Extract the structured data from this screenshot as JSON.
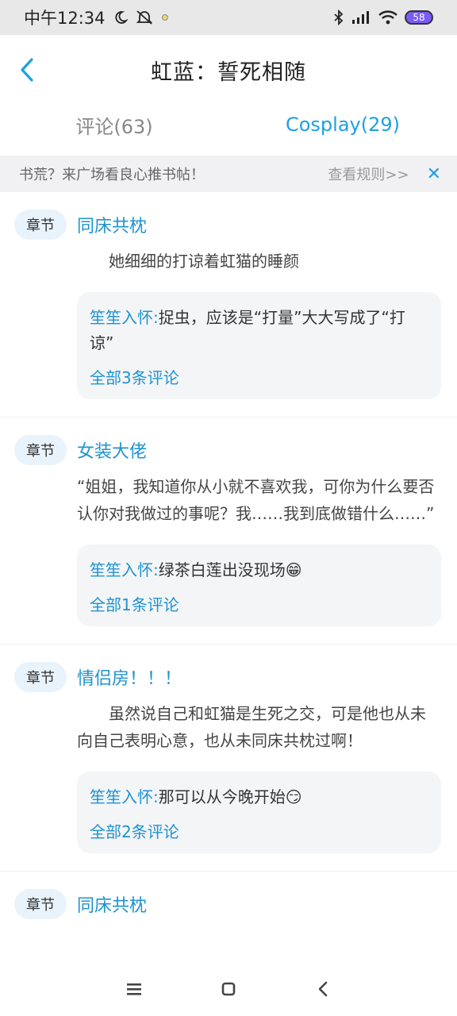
{
  "status_bar": {
    "time": "中午12:34",
    "battery": "58"
  },
  "nav": {
    "title": "虹蓝：誓死相随"
  },
  "tabs": [
    {
      "label": "评论(63)"
    },
    {
      "label": "Cosplay(29)"
    }
  ],
  "notice": {
    "text": "书荒？来广场看良心推书帖！",
    "link": "查看规则>>",
    "close": "✕"
  },
  "cards": [
    {
      "tag": "章节",
      "title": "同床共枕",
      "quote": "　　她细细的打谅着虹猫的睡颜",
      "comment_user": "笙笙入怀:",
      "comment_text": "捉虫，应该是“打量”大大写成了“打谅”",
      "more": "全部3条评论"
    },
    {
      "tag": "章节",
      "title": "女装大佬",
      "quote": "“姐姐，我知道你从小就不喜欢我，可你为什么要否认你对我做过的事呢？我……我到底做错什么……”",
      "comment_user": "笙笙入怀:",
      "comment_text": "绿茶白莲出没现场😁",
      "more": "全部1条评论"
    },
    {
      "tag": "章节",
      "title": "情侣房！！！",
      "quote": "　　虽然说自己和虹猫是生死之交，可是他也从未向自己表明心意，也从未同床共枕过啊！",
      "comment_user": "笙笙入怀:",
      "comment_text": "那可以从今晚开始😏",
      "more": "全部2条评论"
    },
    {
      "tag": "章节",
      "title": "同床共枕"
    }
  ]
}
